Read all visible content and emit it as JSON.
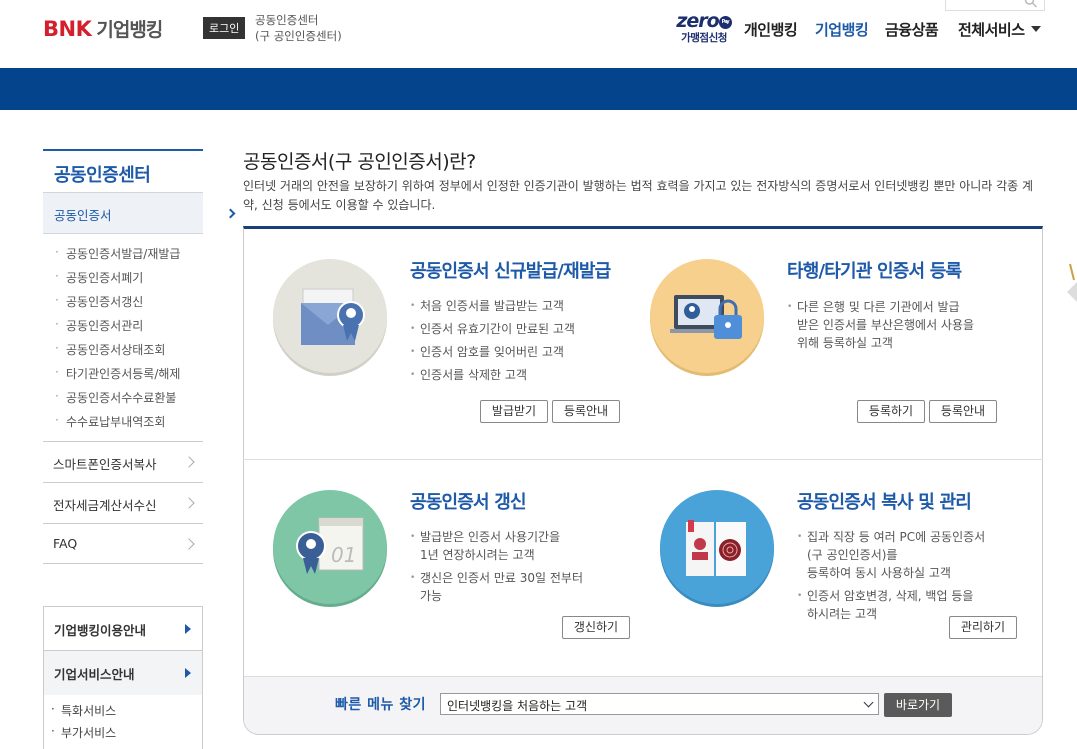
{
  "header": {
    "logo_bnk": "BNK",
    "logo_biz": "기업뱅킹",
    "login": "로그인",
    "cert_center_line1": "공동인증센터",
    "cert_center_line2": "(구 공인인증센터)",
    "zero_word": "zero",
    "zero_badge": "Pay",
    "zero_sub": "가맹점신청",
    "nav": [
      "개인뱅킹",
      "기업뱅킹",
      "금융상품",
      "전체서비스"
    ],
    "nav_active": "기업뱅킹",
    "brand_color": "#04448c",
    "accent_color": "#1e5aa8",
    "logo_color": "#d4202c"
  },
  "sidebar": {
    "title": "공동인증센터",
    "active_item": "공동인증서",
    "sub_items": [
      "공동인증서발급/재발급",
      "공동인증서폐기",
      "공동인증서갱신",
      "공동인증서관리",
      "공동인증서상태조회",
      "타기관인증서등록/해제",
      "공동인증서수수료환불",
      "수수료납부내역조회"
    ],
    "rows": [
      "스마트폰인증서복사",
      "전자세금계산서수신",
      "FAQ"
    ],
    "box_rows": [
      "기업뱅킹이용안내",
      "기업서비스안내"
    ],
    "box_sub": [
      "특화서비스",
      "부가서비스"
    ]
  },
  "main": {
    "title": "공동인증서(구 공인인증서)란?",
    "desc": "인터넷 거래의 안전을 보장하기 위하여 정부에서 인정한 인증기관이 발행하는 법적 효력을 가지고 있는 전자방식의 증명서로서 인터넷뱅킹 뿐만 아니라 각종 계약, 신청 등에서도 이용할 수 있습니다.",
    "cards": [
      {
        "title": "공동인증서 신규발급/재발급",
        "bullets": [
          "처음 인증서를 발급받는 고객",
          "인증서 유효기간이 만료된 고객",
          "인증서 암호를 잊어버린 고객",
          "인증서를 삭제한 고객"
        ],
        "buttons": [
          "발급받기",
          "등록안내"
        ],
        "icon": "envelope-certificate-icon"
      },
      {
        "title": "타행/타기관 인증서 등록",
        "bullets": [
          "다른 은행 및 다른 기관에서 발급\n받은 인증서를 부산은행에서 사용을\n위해 등록하실 고객"
        ],
        "buttons": [
          "등록하기",
          "등록안내"
        ],
        "icon": "monitor-lock-icon"
      },
      {
        "title": "공동인증서 갱신",
        "bullets": [
          "발급받은 인증서 사용기간을\n1년 연장하시려는 고객",
          "갱신은 인증서 만료 30일 전부터\n가능"
        ],
        "buttons": [
          "갱신하기"
        ],
        "icon": "calendar-certificate-icon"
      },
      {
        "title": "공동인증서 복사 및 관리",
        "bullets": [
          "집과 직장 등 여러 PC에 공동인증서\n(구 공인인증서)를\n등록하여 동시 사용하실 고객",
          "인증서 암호변경, 삭제, 백업 등을\n하시려는 고객"
        ],
        "buttons": [
          "관리하기"
        ],
        "icon": "book-fingerprint-icon"
      }
    ],
    "quick": {
      "label": "빠른 메뉴 찾기",
      "selected": "인터넷뱅킹을 처음하는 고객",
      "go": "바로가기"
    }
  }
}
